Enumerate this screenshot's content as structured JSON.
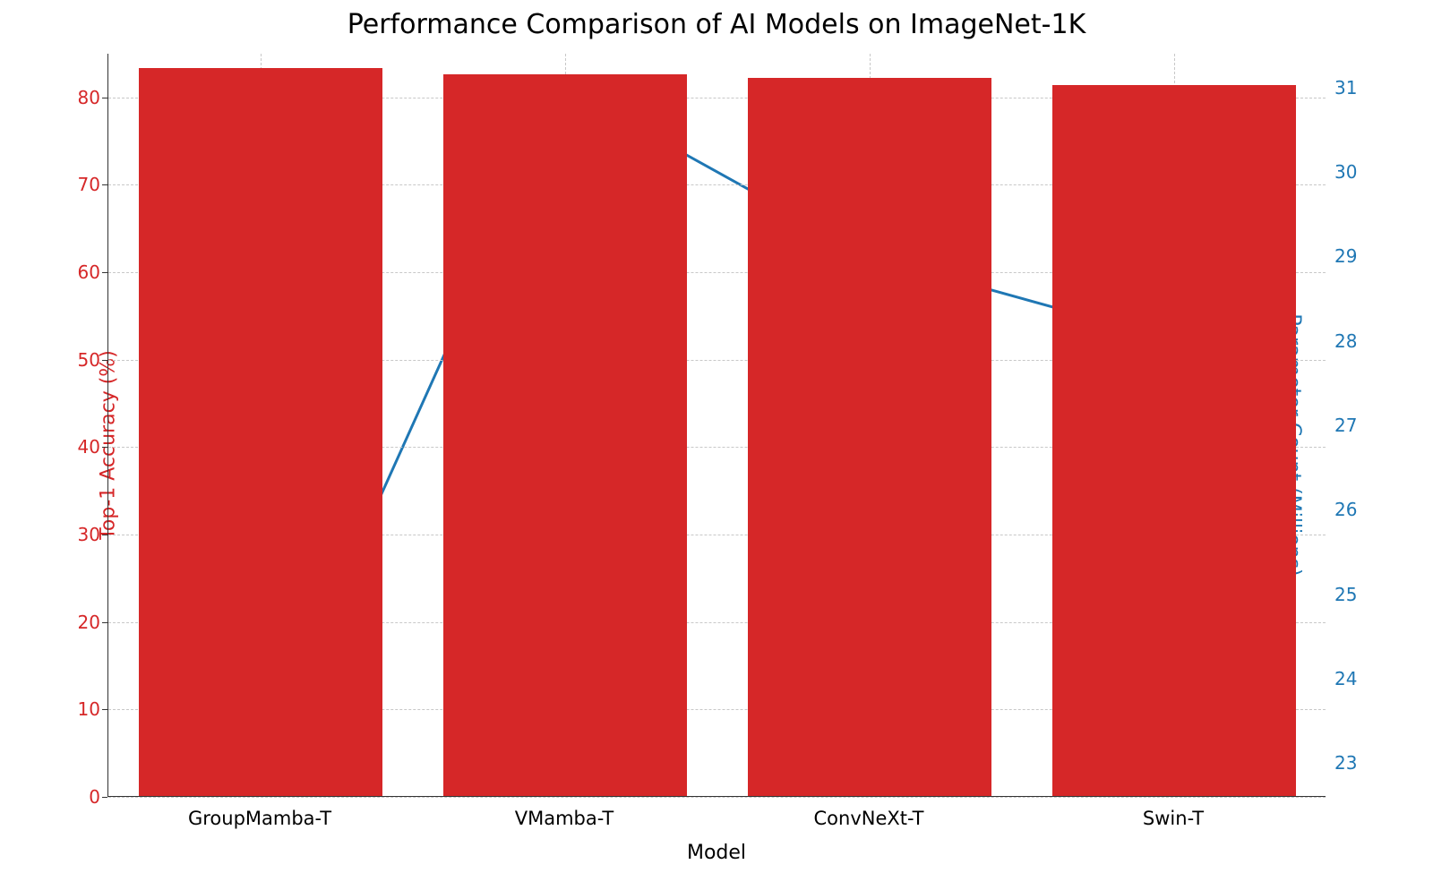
{
  "chart_data": {
    "type": "bar+line",
    "title": "Performance Comparison of AI Models on ImageNet-1K",
    "xlabel": "Model",
    "categories": [
      "GroupMamba-T",
      "VMamba-T",
      "ConvNeXt-T",
      "Swin-T"
    ],
    "series": [
      {
        "name": "Top-1 Accuracy (%)",
        "type": "bar",
        "axis": "left",
        "color": "#d62728",
        "values": [
          83.3,
          82.5,
          82.1,
          81.3
        ]
      },
      {
        "name": "Parameter Count (Millions)",
        "type": "line",
        "axis": "right",
        "color": "#1f77b4",
        "values": [
          23,
          31,
          29,
          28
        ]
      }
    ],
    "y1": {
      "label": "Top-1 Accuracy (%)",
      "color": "#d62728",
      "lim": [
        0,
        85
      ],
      "ticks": [
        0,
        10,
        20,
        30,
        40,
        50,
        60,
        70,
        80
      ]
    },
    "y2": {
      "label": "Parameter Count (Millions)",
      "color": "#1f77b4",
      "lim": [
        22.6,
        31.4
      ],
      "ticks": [
        23,
        24,
        25,
        26,
        27,
        28,
        29,
        30,
        31
      ]
    },
    "grid": true
  }
}
